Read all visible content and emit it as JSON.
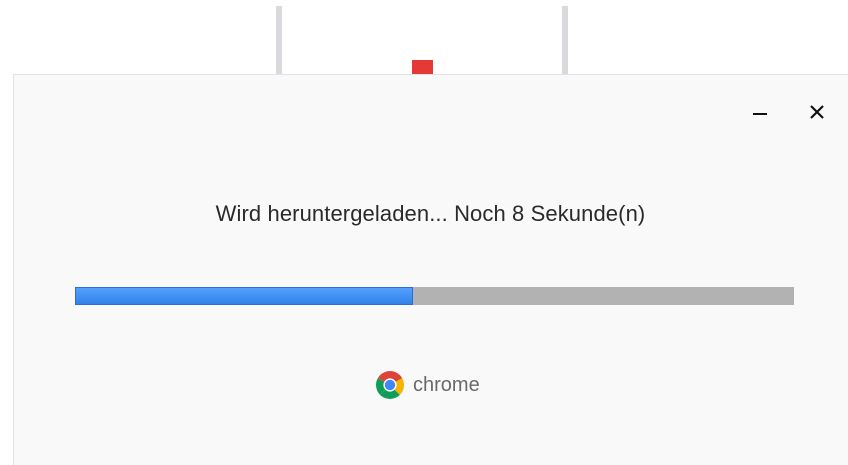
{
  "window": {
    "minimize_label": "–",
    "close_label": "×"
  },
  "download": {
    "status_text": "Wird heruntergeladen... Noch 8 Sekunde(n)",
    "progress_fraction": 0.47
  },
  "branding": {
    "product_name": "chrome",
    "logo_icon": "chrome-logo-icon"
  },
  "colors": {
    "progress_fill": "#3d8cf5",
    "progress_track": "#b2b2b2",
    "dialog_background": "#f9f9f9",
    "background_accent": "#e53935"
  }
}
